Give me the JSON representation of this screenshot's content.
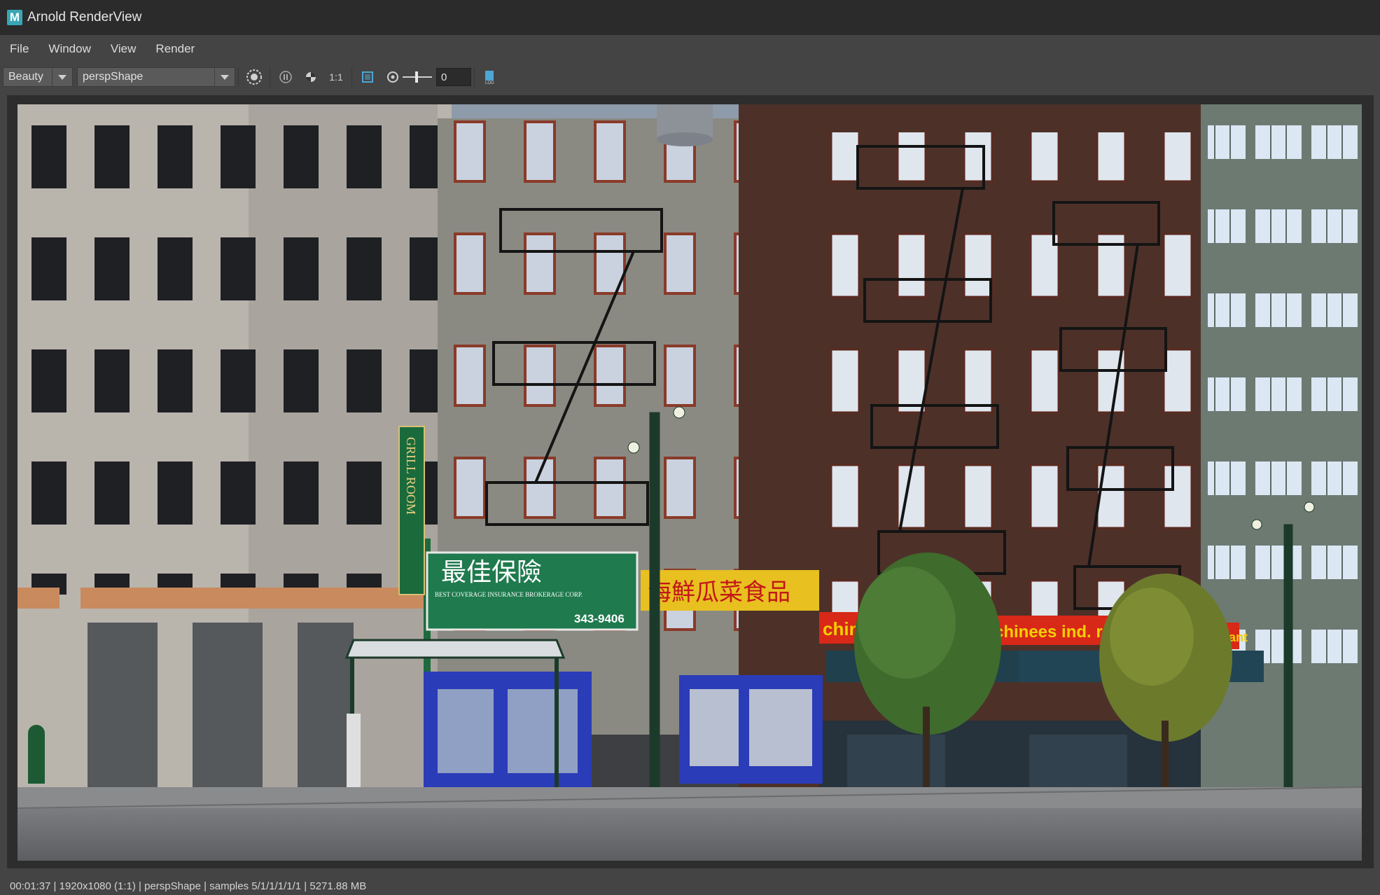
{
  "window": {
    "title": "Arnold RenderView",
    "logo_letter": "M"
  },
  "menu": {
    "items": [
      "File",
      "Window",
      "View",
      "Render"
    ]
  },
  "toolbar": {
    "aov_value": "Beauty",
    "camera_value": "perspShape",
    "ratio_label": "1:1",
    "exposure_value": "0",
    "icons": [
      "render-region-icon",
      "pause-icon",
      "color-channels-icon",
      "ratio-icon",
      "crop-region-icon",
      "exposure-icon",
      "log-icon"
    ]
  },
  "render": {
    "signs": {
      "vertical_sign": "GRILL ROOM",
      "green_sign_title": "最佳保險",
      "green_sign_sub": "BEST COVERAGE INSURANCE BROKERAGE CORP.",
      "green_sign_phone": "343-9406",
      "yellow_sign": "海鮮瓜菜食品",
      "red_sign_left": "chine",
      "red_sign_mid": "chinees ind. resta",
      "red_sign_right": "aurant"
    }
  },
  "status": {
    "text": "00:01:37 | 1920x1080 (1:1) | perspShape  | samples 5/1/1/1/1/1 | 5271.88 MB"
  },
  "colors": {
    "title_bg": "#2b2b2b",
    "ui_bg": "#444444",
    "logo_accent": "#39a7b5"
  }
}
